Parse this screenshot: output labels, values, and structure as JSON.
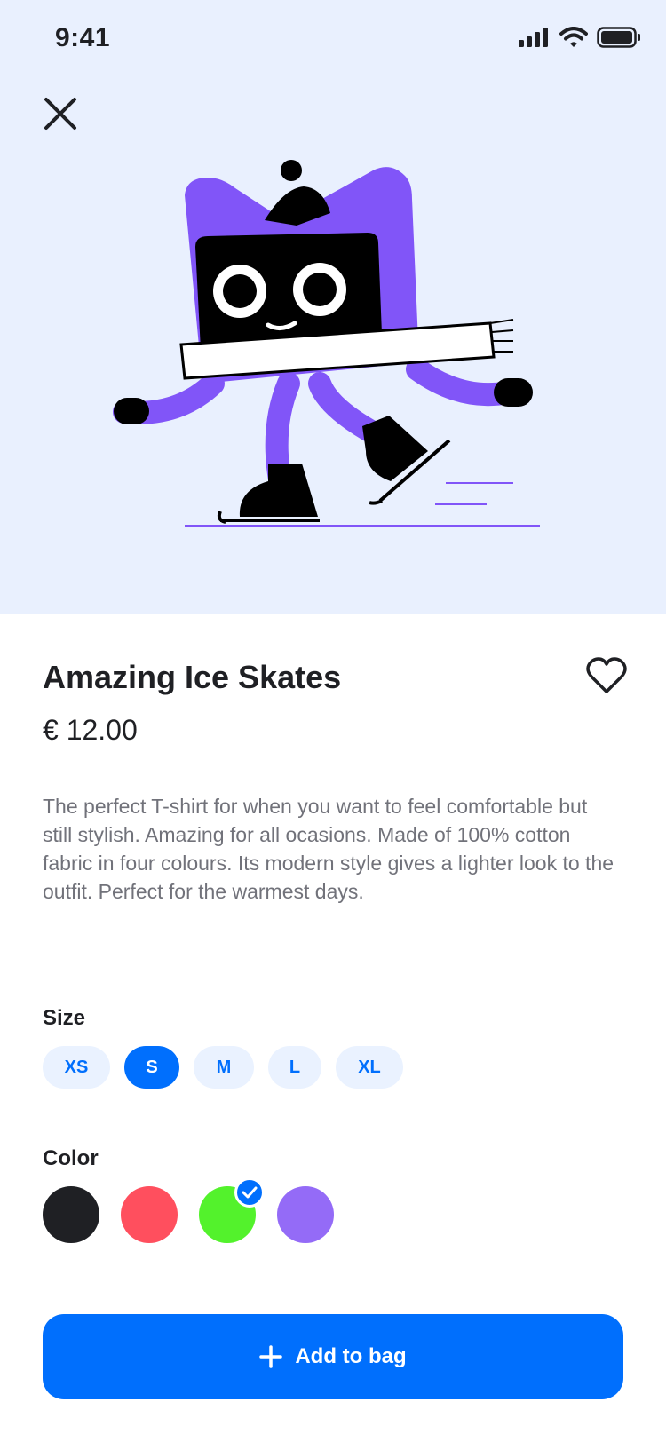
{
  "status": {
    "time": "9:41"
  },
  "product": {
    "title": "Amazing Ice Skates",
    "price": "€ 12.00",
    "description": "The perfect T-shirt for when you want to feel comfortable but still stylish. Amazing for all ocasions. Made of 100% cotton fabric in four colours. Its modern style gives a lighter look to the outfit. Perfect for the warmest days."
  },
  "size": {
    "label": "Size",
    "options": [
      "XS",
      "S",
      "M",
      "L",
      "XL"
    ],
    "selected": "S"
  },
  "color": {
    "label": "Color",
    "options": [
      "#1f2024",
      "#ff4f5e",
      "#53f22c",
      "#946bf7"
    ],
    "selected": "#53f22c"
  },
  "cta": {
    "label": "Add to bag"
  },
  "icons": {
    "close": "close-icon",
    "favorite": "heart-icon",
    "add": "plus-icon",
    "selected": "check-icon"
  },
  "colors": {
    "accent": "#006ffd",
    "hero_bg": "#e9f0fe",
    "mascot": "#8155f8"
  }
}
